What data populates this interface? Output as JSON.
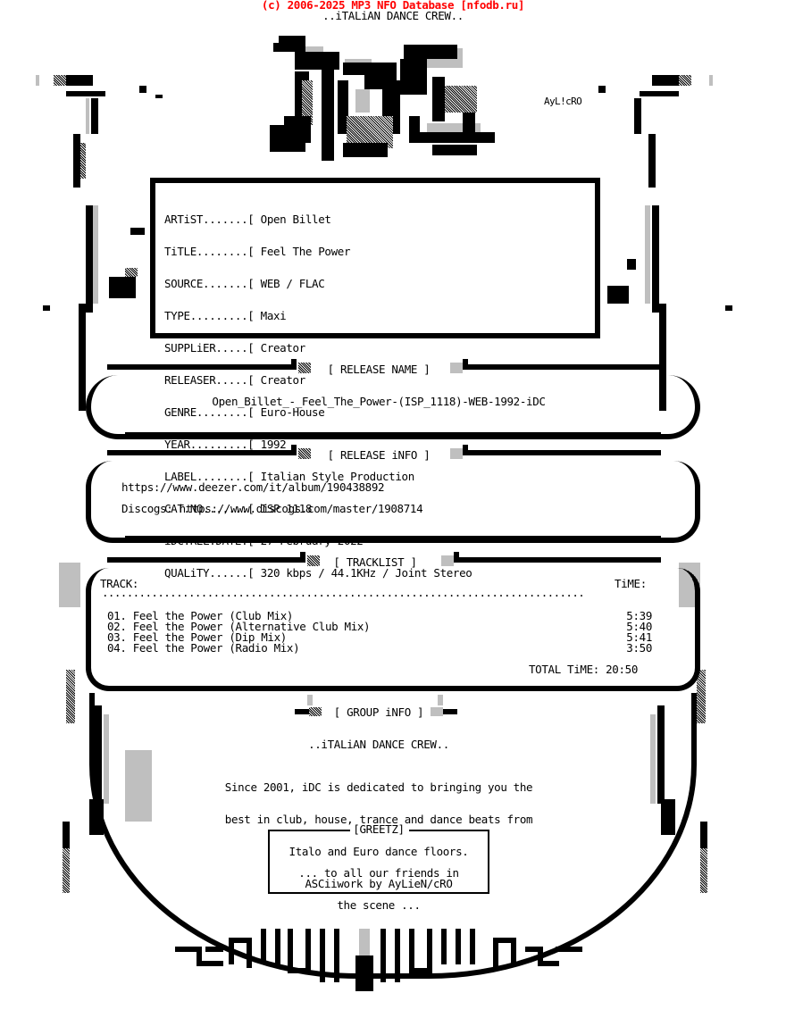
{
  "header": {
    "credit": "(c) 2006-2025 MP3 NFO Database [nfodb.ru]",
    "credit_color": "#ff0000",
    "group_tagline": "..iTALiAN DANCE CREW..",
    "logo": "iDC",
    "artist_tag": "AyL!cRO"
  },
  "info": {
    "fields": [
      {
        "key": "ARTiST.......[",
        "value": "Open Billet"
      },
      {
        "key": "TiTLE........[",
        "value": "Feel The Power"
      },
      {
        "key": "SOURCE.......[",
        "value": "WEB / FLAC"
      },
      {
        "key": "TYPE.........[",
        "value": "Maxi"
      },
      {
        "key": "SUPPLiER.....[",
        "value": "Creator"
      },
      {
        "key": "RELEASER.....[",
        "value": "Creator"
      },
      {
        "key": "GENRE........[",
        "value": "Euro-House"
      },
      {
        "key": "YEAR.........[",
        "value": "1992"
      },
      {
        "key": "LABEL........[",
        "value": "Italian Style Production"
      },
      {
        "key": "CAT.NO.......[",
        "value": "ISP 1118"
      },
      {
        "key": "iDC.REL.DATE.[",
        "value": "27-February-2022"
      },
      {
        "key": "QUALiTY......[",
        "value": "320 kbps / 44.1KHz / Joint Stereo"
      }
    ]
  },
  "release_name": {
    "title": "[ RELEASE NAME ]",
    "value": "Open_Billet_-_Feel_The_Power-(ISP_1118)-WEB-1992-iDC"
  },
  "release_info": {
    "title": "[ RELEASE iNFO ]",
    "lines": [
      "https://www.deezer.com/it/album/190438892",
      "Discogs: https://www.discogs.com/master/1908714"
    ]
  },
  "tracklist": {
    "title": "[ TRACKLIST ]",
    "col_track": "TRACK:",
    "col_time": "TiME:",
    "divider": "..............................................................................",
    "tracks": [
      {
        "num": "01.",
        "title": "Feel the Power (Club Mix)",
        "time": "5:39"
      },
      {
        "num": "02.",
        "title": "Feel the Power (Alternative Club Mix)",
        "time": "5:40"
      },
      {
        "num": "03.",
        "title": "Feel the Power (Dip Mix)",
        "time": "5:41"
      },
      {
        "num": "04.",
        "title": "Feel the Power (Radio Mix)",
        "time": "3:50"
      }
    ],
    "total_label": "TOTAL TiME:",
    "total_value": "20:50"
  },
  "group_info": {
    "title": "[ GROUP iNFO ]",
    "name": "..iTALiAN DANCE CREW..",
    "description": [
      "Since 2001, iDC is dedicated to bringing you the",
      "best in club, house, trance and dance beats from",
      "Italo and Euro dance floors."
    ]
  },
  "greetz": {
    "title": "[GREETZ]",
    "lines": [
      "... to all our friends in",
      "the scene ..."
    ],
    "credit": "ASCiiwork by AyLieN/cRO"
  }
}
